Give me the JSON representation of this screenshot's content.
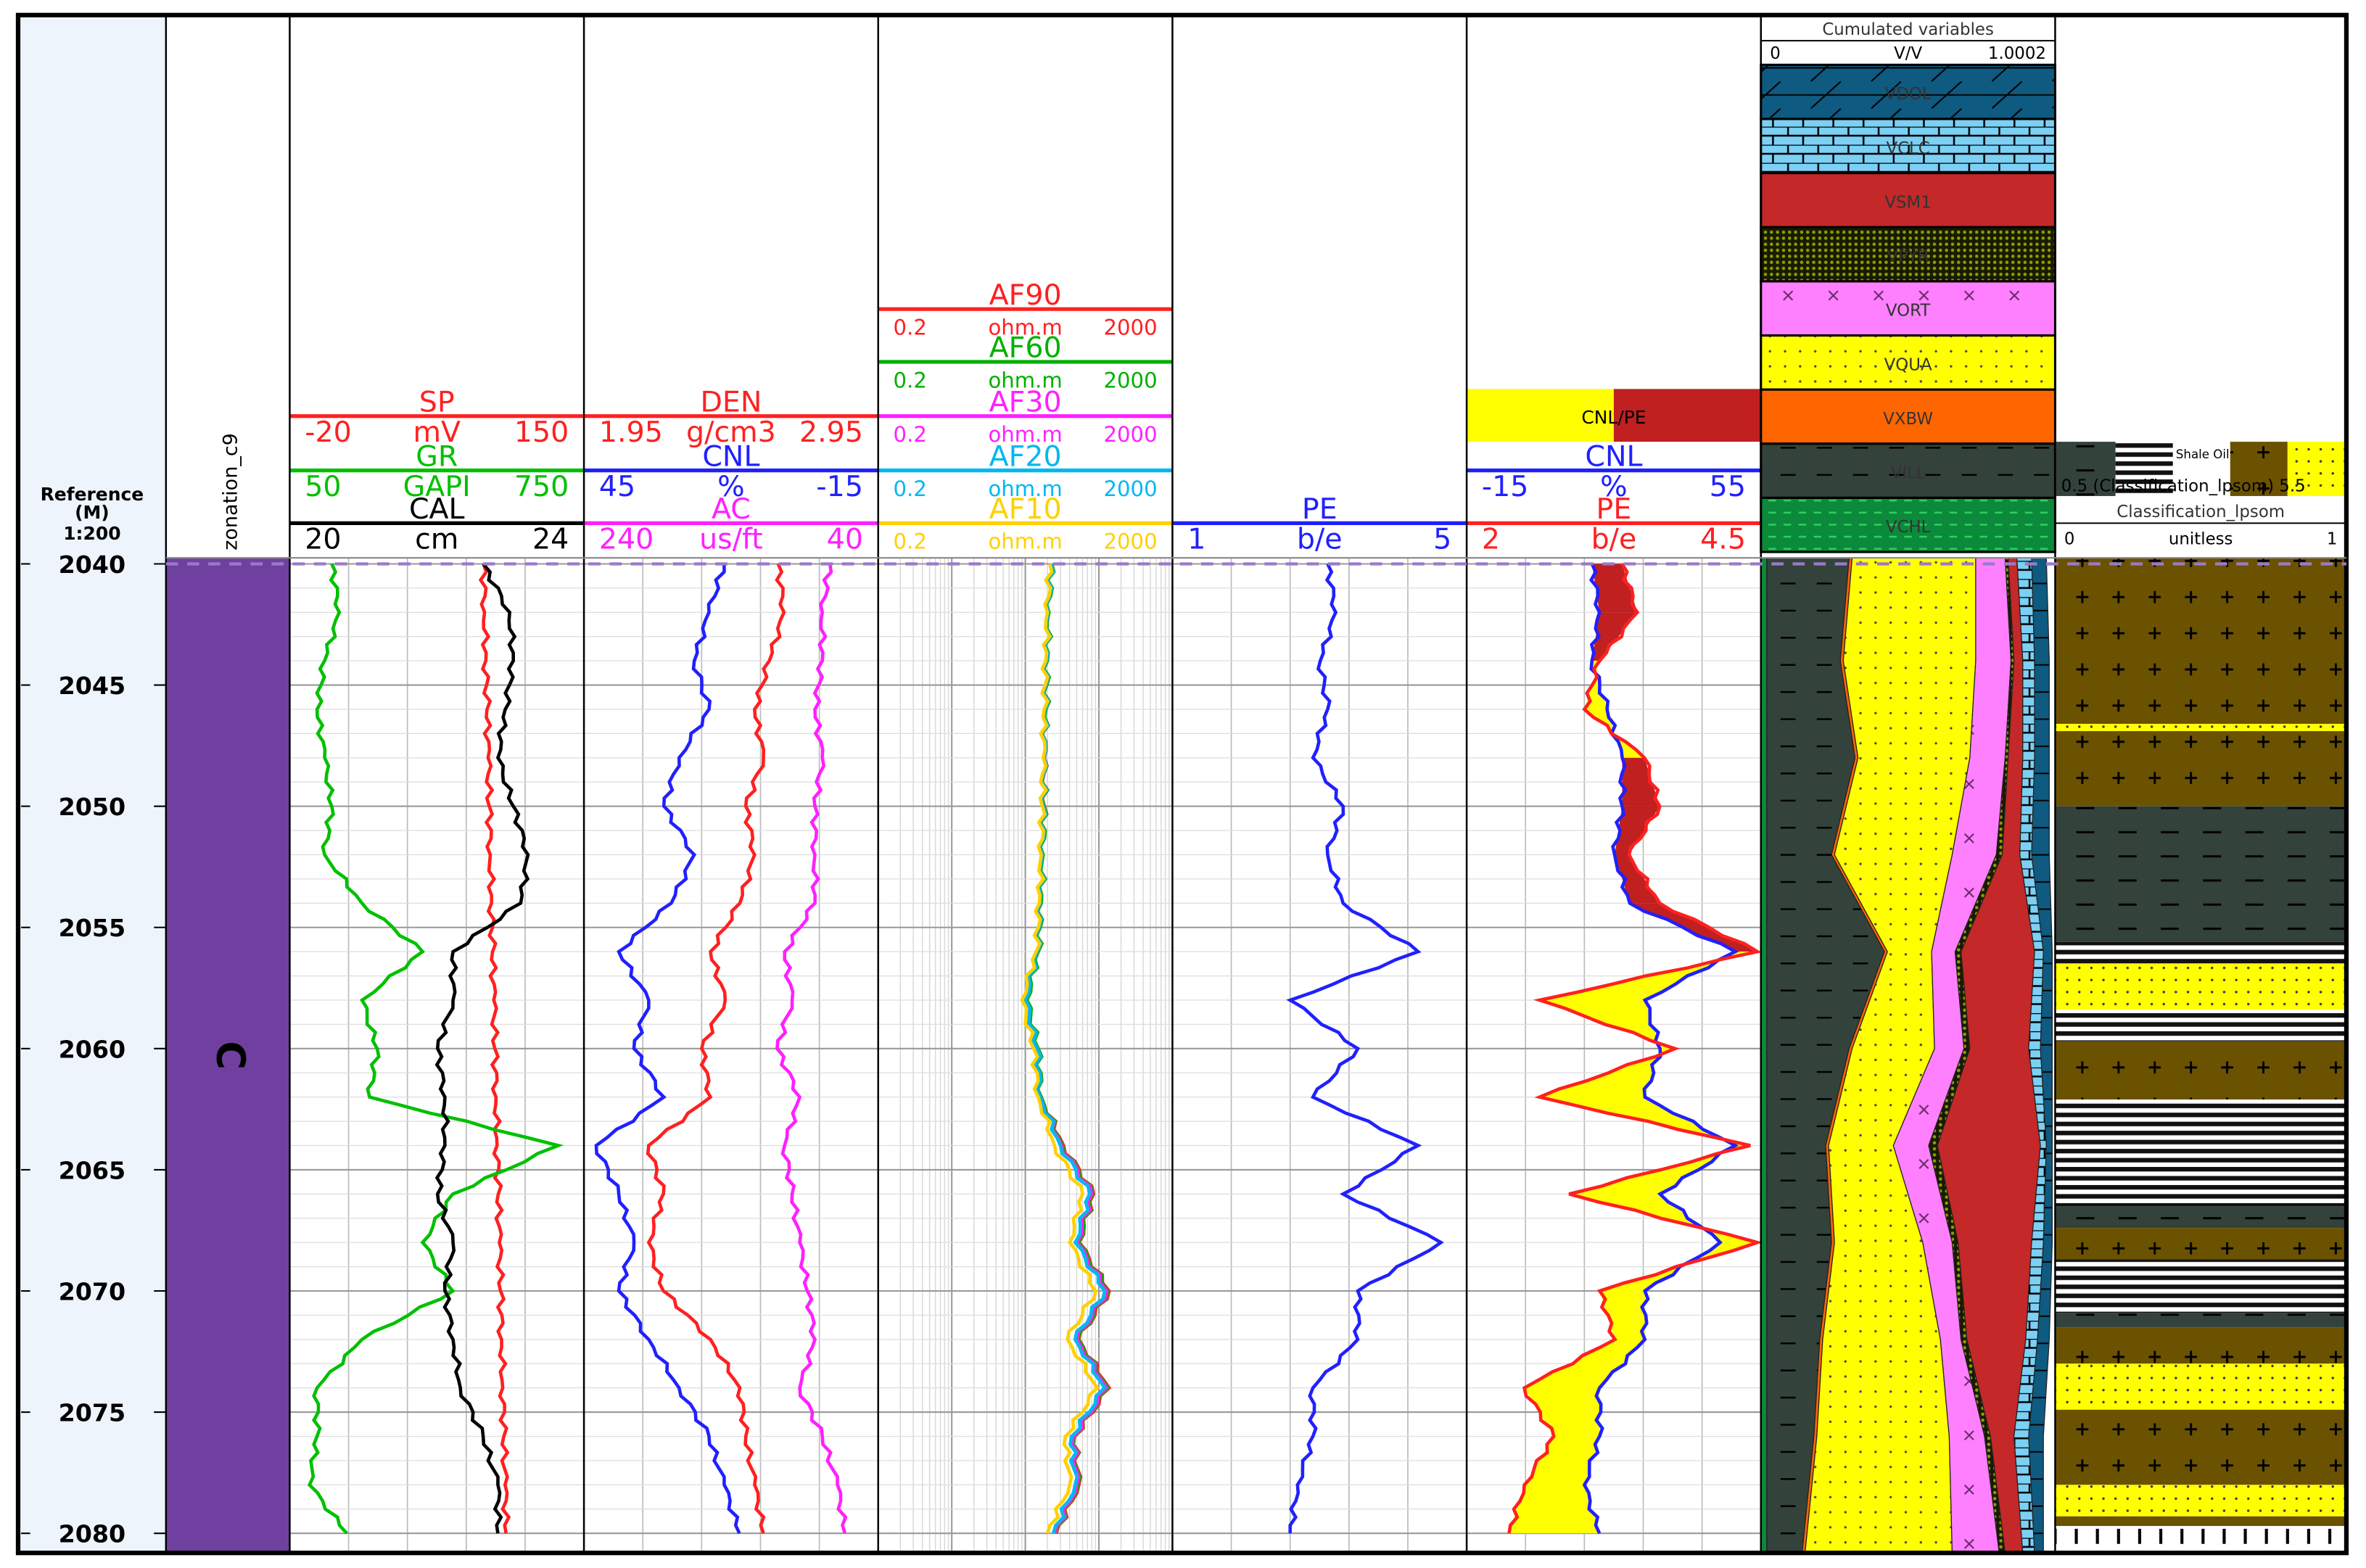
{
  "depth_track": {
    "title": "Reference",
    "unit": "(M)",
    "scale": "1:200"
  },
  "zonation": {
    "title": "zonation_c9",
    "zones": [
      {
        "name": "C",
        "top": 2039.75,
        "bottom": 2080.8,
        "color": "#7040a0"
      }
    ]
  },
  "chart_data": {
    "type": "line",
    "depth_range": [
      2039.75,
      2080.8
    ],
    "depth_ticks": [
      "2040",
      "2045",
      "2050",
      "2055",
      "2060",
      "2065",
      "2070",
      "2075",
      "2080"
    ],
    "depth": [
      2040,
      2042,
      2044,
      2046,
      2048,
      2050,
      2052,
      2054,
      2056,
      2058,
      2060,
      2062,
      2064,
      2066,
      2068,
      2070,
      2072,
      2074,
      2076,
      2078,
      2080
    ],
    "tracks": [
      {
        "id": "t1",
        "scale": "linear",
        "curves": [
          {
            "name": "SP",
            "left": "-20",
            "unit": "mV",
            "right": "150",
            "color": "#ff2020",
            "values": [
              92,
              92.6,
              93.3,
              94,
              94.6,
              95.3,
              95.9,
              96.6,
              97.2,
              97.9,
              98.5,
              99.2,
              99.8,
              100.5,
              101.1,
              101.8,
              102.4,
              103.1,
              103.7,
              104.4,
              105
            ]
          },
          {
            "name": "GR",
            "left": "50",
            "unit": "GAPI",
            "right": "750",
            "color": "#00c000",
            "values": [
              150,
              168,
              133,
              115,
              133,
              150,
              133,
              222,
              366,
              222,
              258,
              240,
              689,
              438,
              366,
              438,
              222,
              115,
              115,
              97,
              186
            ]
          },
          {
            "name": "CAL",
            "left": "20",
            "unit": "cm",
            "right": "24",
            "color": "#000000",
            "values": [
              22.63,
              22.99,
              23.04,
              22.93,
              22.83,
              23.04,
              23.24,
              23.14,
              22.22,
              22.22,
              22.01,
              22.11,
              22.11,
              22.01,
              22.22,
              22.11,
              22.22,
              22.32,
              22.63,
              22.83,
              22.83
            ]
          }
        ]
      },
      {
        "id": "t2",
        "scale": "linear",
        "curves": [
          {
            "name": "DEN",
            "left": "1.95",
            "unit": "g/cm3",
            "right": "2.95",
            "color": "#ff2020",
            "values": [
              2.61,
              2.63,
              2.58,
              2.53,
              2.56,
              2.5,
              2.53,
              2.48,
              2.38,
              2.43,
              2.35,
              2.38,
              2.17,
              2.22,
              2.17,
              2.22,
              2.38,
              2.48,
              2.5,
              2.53,
              2.56
            ]
          },
          {
            "name": "CNL",
            "left": "45",
            "unit": "%",
            "right": "-15",
            "color": "#2020ff",
            "values": [
              16.4,
              19.5,
              22.5,
              19.5,
              25.6,
              28.7,
              22.5,
              27.2,
              37.9,
              31.8,
              34.8,
              28.7,
              42.5,
              37.9,
              34.8,
              37.9,
              31.8,
              25.6,
              19.5,
              16.4,
              13.3
            ]
          },
          {
            "name": "AC",
            "left": "240",
            "unit": "us/ft",
            "right": "40",
            "color": "#ff20ff",
            "values": [
              72.8,
              78,
              78,
              83,
              78,
              83,
              83,
              83,
              103.6,
              98.5,
              108.7,
              93.3,
              103.6,
              98.5,
              93.3,
              88.2,
              83,
              93.3,
              78,
              67.7,
              62.6
            ]
          }
        ]
      },
      {
        "id": "t3",
        "scale": "log",
        "curves": [
          {
            "name": "AF90",
            "left": "0.2",
            "unit": "ohm.m",
            "right": "2000",
            "color": "#ff2020",
            "values": [
              45.8,
              41.6,
              39.9,
              38,
              36.3,
              36.3,
              34.6,
              33,
              29.9,
              20.5,
              29.9,
              33,
              66.3,
              170,
              107,
              276,
              107,
              276,
              93.5,
              107,
              52.6
            ]
          },
          {
            "name": "AF60",
            "left": "0.2",
            "unit": "ohm.m",
            "right": "2000",
            "color": "#00b000",
            "values": [
              46,
              42,
              40,
              38,
              36,
              36,
              35,
              33,
              30,
              21,
              30,
              33,
              64,
              165,
              105,
              265,
              105,
              265,
              92,
              104,
              51
            ]
          },
          {
            "name": "AF30",
            "left": "0.2",
            "unit": "ohm.m",
            "right": "2000",
            "color": "#ff20ff",
            "values": [
              45,
              41,
              39,
              37,
              36,
              35,
              34,
              32,
              29,
              20,
              29,
              32,
              62,
              160,
              100,
              255,
              100,
              255,
              90,
              100,
              50
            ]
          },
          {
            "name": "AF20",
            "left": "0.2",
            "unit": "ohm.m",
            "right": "2000",
            "color": "#00b8f0",
            "values": [
              45,
              41,
              39,
              37,
              36,
              35,
              34,
              32,
              29,
              20,
              29,
              32,
              60,
              150,
              95,
              240,
              95,
              240,
              85,
              95,
              48
            ]
          },
          {
            "name": "AF10",
            "left": "0.2",
            "unit": "ohm.m",
            "right": "2000",
            "color": "#ffd000",
            "values": [
              43,
              40,
              38,
              36,
              35,
              34,
              33,
              31,
              28,
              18,
              26,
              30,
              50,
              120,
              80,
              180,
              75,
              190,
              70,
              80,
              40
            ]
          }
        ]
      },
      {
        "id": "t4",
        "scale": "linear",
        "curves": [
          {
            "name": "PE",
            "left": "1",
            "unit": "b/e",
            "right": "5",
            "color": "#2020ff",
            "values": [
              3.11,
              3.22,
              3.01,
              3.11,
              2.91,
              3.32,
              3.11,
              3.32,
              4.34,
              2.6,
              3.52,
              2.91,
              4.34,
              3.32,
              4.65,
              3.52,
              3.52,
              2.91,
              2.91,
              2.7,
              2.6
            ]
          }
        ]
      },
      {
        "id": "t5",
        "scale": "linear",
        "fill_label": "CNL/PE",
        "fill_colors": [
          "#ffff00",
          "#c02020"
        ],
        "curves": [
          {
            "name": "CNL",
            "left": "-15",
            "unit": "%",
            "right": "55",
            "color": "#2020ff",
            "values": [
              14.8,
              16.6,
              14.8,
              18.4,
              22,
              22,
              20.2,
              23.8,
              48.9,
              27.4,
              31,
              27.4,
              48.9,
              31,
              45.3,
              27.4,
              27.4,
              16.6,
              16.6,
              13,
              16.6
            ]
          },
          {
            "name": "PE",
            "left": "2",
            "unit": "b/e",
            "right": "4.5",
            "color": "#ff2020",
            "values": [
              3.32,
              3.45,
              3.13,
              3.0,
              3.51,
              3.64,
              3.38,
              3.64,
              4.47,
              2.62,
              3.77,
              2.62,
              4.41,
              2.87,
              4.47,
              3.13,
              3.26,
              2.49,
              2.74,
              2.49,
              2.36
            ]
          }
        ]
      }
    ],
    "cumulated": {
      "title": "Cumulated variables",
      "left": "0",
      "unit": "V/V",
      "right": "1.0002",
      "depth": [
        2040,
        2044,
        2048,
        2052,
        2056,
        2060,
        2064,
        2068,
        2072,
        2076,
        2080
      ],
      "components": [
        {
          "name": "VCHL",
          "color": "#0a8a3a",
          "values": [
            0.02,
            0.02,
            0.02,
            0.02,
            0.02,
            0.02,
            0.02,
            0.02,
            0.02,
            0.02,
            0.02
          ]
        },
        {
          "name": "VILL",
          "color": "#34423c",
          "values": [
            0.28,
            0.25,
            0.3,
            0.22,
            0.4,
            0.28,
            0.2,
            0.22,
            0.18,
            0.16,
            0.12
          ]
        },
        {
          "name": "VXBW",
          "color": "#ff6600",
          "values": [
            0.01,
            0.01,
            0.01,
            0.01,
            0.01,
            0.01,
            0.01,
            0.01,
            0.01,
            0.01,
            0.01
          ]
        },
        {
          "name": "VQUA",
          "color": "#ffff00",
          "values": [
            0.42,
            0.45,
            0.38,
            0.4,
            0.15,
            0.28,
            0.22,
            0.3,
            0.4,
            0.45,
            0.5
          ]
        },
        {
          "name": "VORT",
          "color": "#ff80ff",
          "values": [
            0.1,
            0.12,
            0.12,
            0.15,
            0.08,
            0.1,
            0.12,
            0.1,
            0.07,
            0.12,
            0.16
          ]
        },
        {
          "name": "VPYR",
          "color": "#6a7a00",
          "values": [
            0.01,
            0.01,
            0.01,
            0.02,
            0.02,
            0.02,
            0.03,
            0.02,
            0.02,
            0.02,
            0.02
          ]
        },
        {
          "name": "VSM1",
          "color": "#c42828",
          "values": [
            0.03,
            0.03,
            0.05,
            0.06,
            0.25,
            0.2,
            0.35,
            0.25,
            0.2,
            0.08,
            0.06
          ]
        },
        {
          "name": "VCLC",
          "color": "#7cd0f4",
          "values": [
            0.05,
            0.04,
            0.04,
            0.04,
            0.03,
            0.04,
            0.02,
            0.04,
            0.04,
            0.05,
            0.04
          ]
        },
        {
          "name": "VDOL",
          "color": "#0f5a80",
          "values": [
            0.05,
            0.05,
            0.05,
            0.06,
            0.03,
            0.04,
            0.02,
            0.03,
            0.04,
            0.05,
            0.03
          ]
        }
      ]
    },
    "classification": {
      "title": "Classification_lpsom",
      "left": "0",
      "unit": "unitless",
      "right": "1",
      "range_label": "0.5 (Classification_lpsom) 5.5",
      "legend_label": "Shale Oil",
      "classes": [
        {
          "code": 1,
          "color": "#34423c",
          "pattern": "dashes"
        },
        {
          "code": 2,
          "color": "#000000",
          "pattern": "stripes"
        },
        {
          "code": 3,
          "color": "#ffff00",
          "pattern": "dots"
        },
        {
          "code": 4,
          "color": "#6b5200",
          "pattern": "crosses"
        },
        {
          "code": 5,
          "color": "#ffffff",
          "pattern": "ticks"
        }
      ],
      "intervals": [
        {
          "top": 2039.75,
          "bottom": 2046.6,
          "class": 4
        },
        {
          "top": 2046.6,
          "bottom": 2046.9,
          "class": 3
        },
        {
          "top": 2046.9,
          "bottom": 2050.0,
          "class": 4
        },
        {
          "top": 2050.0,
          "bottom": 2055.6,
          "class": 1
        },
        {
          "top": 2055.6,
          "bottom": 2056.5,
          "class": 2
        },
        {
          "top": 2056.5,
          "bottom": 2058.4,
          "class": 3
        },
        {
          "top": 2058.4,
          "bottom": 2059.7,
          "class": 2
        },
        {
          "top": 2059.7,
          "bottom": 2062.1,
          "class": 4
        },
        {
          "top": 2062.1,
          "bottom": 2066.5,
          "class": 2
        },
        {
          "top": 2066.5,
          "bottom": 2067.4,
          "class": 1
        },
        {
          "top": 2067.4,
          "bottom": 2068.7,
          "class": 4
        },
        {
          "top": 2068.7,
          "bottom": 2070.9,
          "class": 2
        },
        {
          "top": 2070.9,
          "bottom": 2071.5,
          "class": 1
        },
        {
          "top": 2071.5,
          "bottom": 2073.0,
          "class": 4
        },
        {
          "top": 2073.0,
          "bottom": 2074.9,
          "class": 3
        },
        {
          "top": 2074.9,
          "bottom": 2078.0,
          "class": 4
        },
        {
          "top": 2078.0,
          "bottom": 2079.3,
          "class": 3
        },
        {
          "top": 2079.3,
          "bottom": 2079.7,
          "class": 4
        },
        {
          "top": 2079.7,
          "bottom": 2080.8,
          "class": 5
        }
      ]
    }
  }
}
